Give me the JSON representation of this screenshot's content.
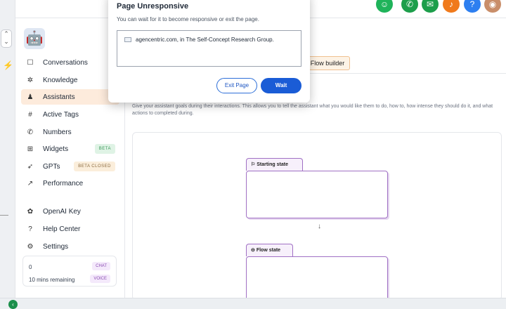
{
  "colors": {
    "accent": "#1a5cd6",
    "active_nav": "#fdebdc",
    "state_border": "#a070c4"
  },
  "topbar": {
    "icons": [
      {
        "name": "bot-icon",
        "glyph": "☺",
        "color": "#1fb35a"
      },
      {
        "name": "phone-icon",
        "glyph": "✆",
        "color": "#1d9e4b"
      },
      {
        "name": "megaphone-icon",
        "glyph": "✉",
        "color": "#1d9e4b"
      },
      {
        "name": "bell-icon",
        "glyph": "♪",
        "color": "#f07a1c"
      },
      {
        "name": "help-icon",
        "glyph": "?",
        "color": "#2d7ff0"
      },
      {
        "name": "avatar",
        "glyph": "◉",
        "color": "#c98e6a"
      }
    ]
  },
  "sidebar": {
    "items": [
      {
        "label": "Conversations",
        "icon": "chat-icon",
        "glyph": "☐"
      },
      {
        "label": "Knowledge",
        "icon": "network-icon",
        "glyph": "✲"
      },
      {
        "label": "Assistants",
        "icon": "user-plus-icon",
        "glyph": "♟",
        "active": true
      },
      {
        "label": "Active Tags",
        "icon": "hash-icon",
        "glyph": "#"
      },
      {
        "label": "Numbers",
        "icon": "phone-icon",
        "glyph": "✆"
      },
      {
        "label": "Widgets",
        "icon": "grid-icon",
        "glyph": "⊞",
        "badge": "BETA"
      },
      {
        "label": "GPTs",
        "icon": "rocket-icon",
        "glyph": "➶",
        "badge": "BETA CLOSED"
      },
      {
        "label": "Performance",
        "icon": "trend-icon",
        "glyph": "↗"
      },
      {
        "label": "OpenAI Key",
        "icon": "openai-icon",
        "glyph": "✿"
      },
      {
        "label": "Help Center",
        "icon": "question-icon",
        "glyph": "?"
      },
      {
        "label": "Settings",
        "icon": "gear-icon",
        "glyph": "⚙"
      }
    ],
    "usage": {
      "count": "0",
      "remaining": "10 mins remaining",
      "chat_tag": "CHAT",
      "voice_tag": "VOICE"
    }
  },
  "main": {
    "flow_builder_tab": "Flow builder",
    "description": "Give your assistant goals during their interactions. This allows you to tell the assistant what you would like them to do, how to, how intense they should do it, and what actions to completed during.",
    "states": [
      {
        "label": "Starting state",
        "icon": "flag-icon"
      },
      {
        "label": "Flow state",
        "icon": "link-icon"
      }
    ]
  },
  "modal": {
    "title": "Page Unresponsive",
    "message": "You can wait for it to become responsive or exit the page.",
    "page_line": "agencentric.com, in The Self-Concept Research Group.",
    "exit_label": "Exit Page",
    "wait_label": "Wait"
  }
}
